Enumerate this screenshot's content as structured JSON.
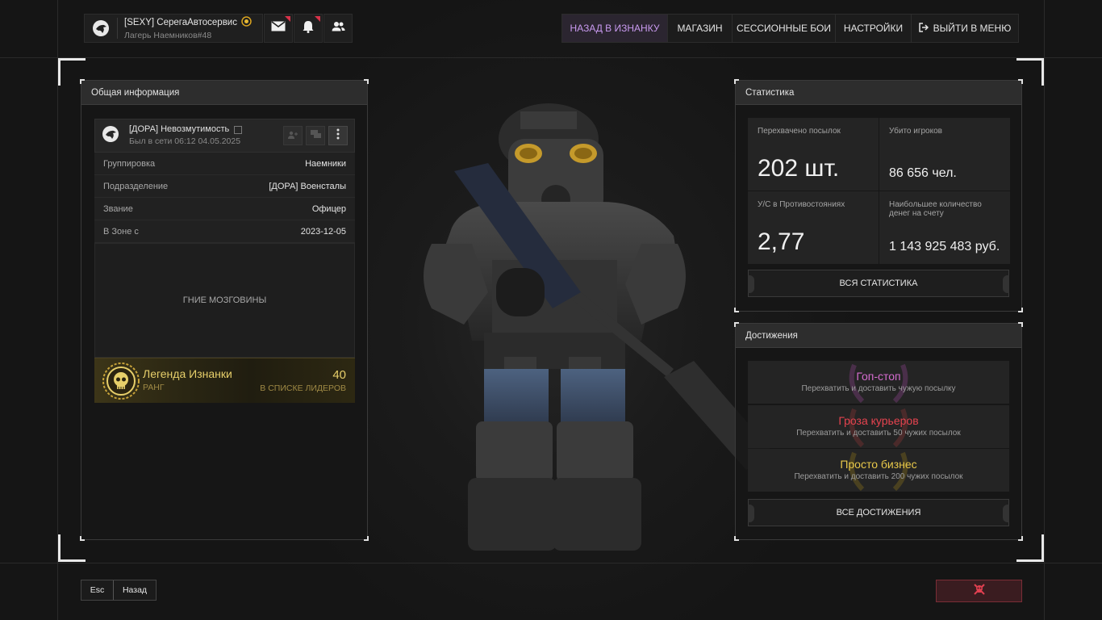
{
  "header": {
    "player_name": "[SEXY] СерегаАвтосервис",
    "player_sub": "Лагерь Наемников#48",
    "icons": [
      "eagle-icon",
      "gold-badge-icon",
      "mail-icon",
      "bell-icon",
      "friends-icon"
    ]
  },
  "nav": {
    "items": [
      {
        "label": "НАЗАД В ИЗНАНКУ",
        "active": true
      },
      {
        "label": "МАГАЗИН",
        "active": false
      },
      {
        "label": "СЕССИОННЫЕ БОИ",
        "active": false
      },
      {
        "label": "НАСТРОЙКИ",
        "active": false
      },
      {
        "label": "ВЫЙТИ В МЕНЮ",
        "active": false,
        "icon": "exit-icon"
      }
    ]
  },
  "info_panel": {
    "title": "Общая информация",
    "user": {
      "name": "[ДОРА] Невозмутимость",
      "last_seen": "Был в сети 06:12 04.05.2025"
    },
    "rows": [
      {
        "key": "Группировка",
        "value": "Наемники"
      },
      {
        "key": "Подразделение",
        "value": "[ДОРА] Военсталы"
      },
      {
        "key": "Звание",
        "value": "Офицер"
      },
      {
        "key": "В Зоне с",
        "value": "2023-12-05"
      }
    ],
    "motto": "ГНИЕ МОЗГОВИНЫ",
    "rank": {
      "name": "Легенда Изнанки",
      "label": "РАНГ",
      "place": "40",
      "place_label": "В СПИСКЕ ЛИДЕРОВ"
    }
  },
  "stats_panel": {
    "title": "Статистика",
    "cells": [
      {
        "label": "Перехвачено посылок",
        "value": "202 шт."
      },
      {
        "label": "Убито игроков",
        "value": "86 656 чел."
      },
      {
        "label": "У/С в Противостояниях",
        "value": "2,77"
      },
      {
        "label": "Наибольшее количество денег на счету",
        "value": "1 143 925 483 руб."
      }
    ],
    "button": "ВСЯ СТАТИСТИКА"
  },
  "achievements_panel": {
    "title": "Достижения",
    "items": [
      {
        "title": "Гоп-стоп",
        "desc": "Перехватить и доставить чужую посылку",
        "color": "#d56ccf"
      },
      {
        "title": "Гроза курьеров",
        "desc": "Перехватить и доставить 50 чужих посылок",
        "color": "#e5434f"
      },
      {
        "title": "Просто бизнес",
        "desc": "Перехватить и доставить 200 чужих посылок",
        "color": "#e8c84a"
      }
    ],
    "button": "ВСЕ ДОСТИЖЕНИЯ"
  },
  "footer": {
    "esc_key": "Esc",
    "esc_label": "Назад",
    "report_icon": "skull-crossbones-icon"
  },
  "colors": {
    "accent_purple": "#c99af0",
    "gold": "#e7cf6a",
    "report_red": "#d9334a"
  }
}
